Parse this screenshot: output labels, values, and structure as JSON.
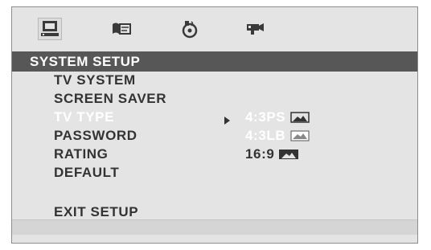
{
  "tabs": [
    {
      "name": "system",
      "icon": "monitor-icon",
      "active": true
    },
    {
      "name": "language",
      "icon": "language-icon",
      "active": false
    },
    {
      "name": "audio",
      "icon": "speaker-disc-icon",
      "active": false
    },
    {
      "name": "video",
      "icon": "video-camera-icon",
      "active": false
    }
  ],
  "header": {
    "title": "SYSTEM SETUP"
  },
  "menu": {
    "items": [
      {
        "label": "TV SYSTEM"
      },
      {
        "label": "SCREEN SAVER"
      },
      {
        "label": "TV TYPE"
      },
      {
        "label": "PASSWORD"
      },
      {
        "label": "RATING"
      },
      {
        "label": "DEFAULT"
      },
      {
        "label": "EXIT SETUP"
      }
    ],
    "selected_item": "TV TYPE"
  },
  "tv_type_options": {
    "items": [
      {
        "label": "4:3PS",
        "icon": "aspect-4-3-pan-scan-icon"
      },
      {
        "label": "4:3LB",
        "icon": "aspect-4-3-letterbox-icon"
      },
      {
        "label": "16:9",
        "icon": "aspect-16-9-icon"
      }
    ],
    "selected": "4:3PS"
  },
  "colors": {
    "background": "#e4e4e4",
    "header_bar": "#575757",
    "text": "#333333",
    "highlight_text": "#ffffff"
  }
}
